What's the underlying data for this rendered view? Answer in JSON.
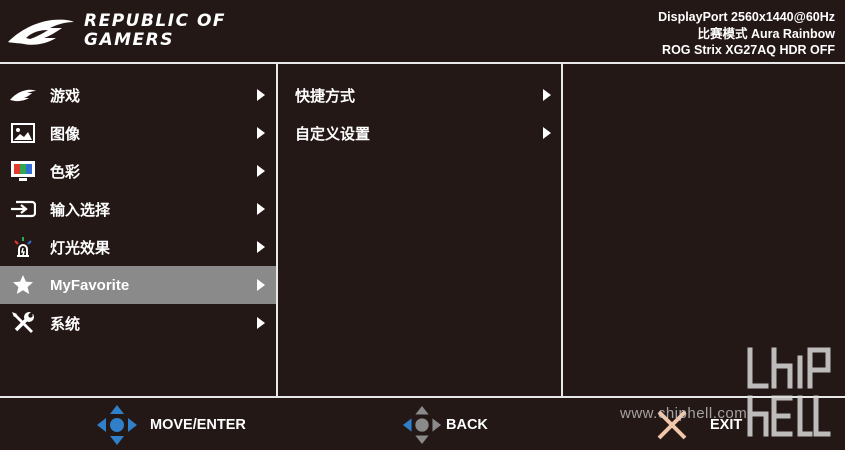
{
  "header": {
    "brand_line1": "REPUBLIC OF",
    "brand_line2": "GAMERS",
    "info": [
      "DisplayPort 2560x1440@60Hz",
      "比赛模式  Aura Rainbow",
      "ROG Strix XG27AQ HDR OFF"
    ]
  },
  "menu": {
    "items": [
      {
        "label": "游戏",
        "icon": "rog-eye-icon"
      },
      {
        "label": "图像",
        "icon": "image-icon"
      },
      {
        "label": "色彩",
        "icon": "color-monitor-icon"
      },
      {
        "label": "输入选择",
        "icon": "input-icon"
      },
      {
        "label": "灯光效果",
        "icon": "light-icon"
      },
      {
        "label": "MyFavorite",
        "icon": "star-icon",
        "active": true
      },
      {
        "label": "系统",
        "icon": "tools-icon"
      }
    ]
  },
  "submenu": {
    "items": [
      {
        "label": "快捷方式"
      },
      {
        "label": "自定义设置"
      }
    ]
  },
  "footer": {
    "move_label": "MOVE/ENTER",
    "back_label": "BACK",
    "exit_label": "EXIT"
  },
  "watermark": {
    "text": "www.chiphell.com"
  },
  "colors": {
    "background": "#231815",
    "frame": "#e8e8e8",
    "active_row": "#8a8a8a",
    "nav_blue": "#2f7fc9",
    "nav_gray": "#8a8a8a",
    "exit_x": "#f2c6a8"
  }
}
